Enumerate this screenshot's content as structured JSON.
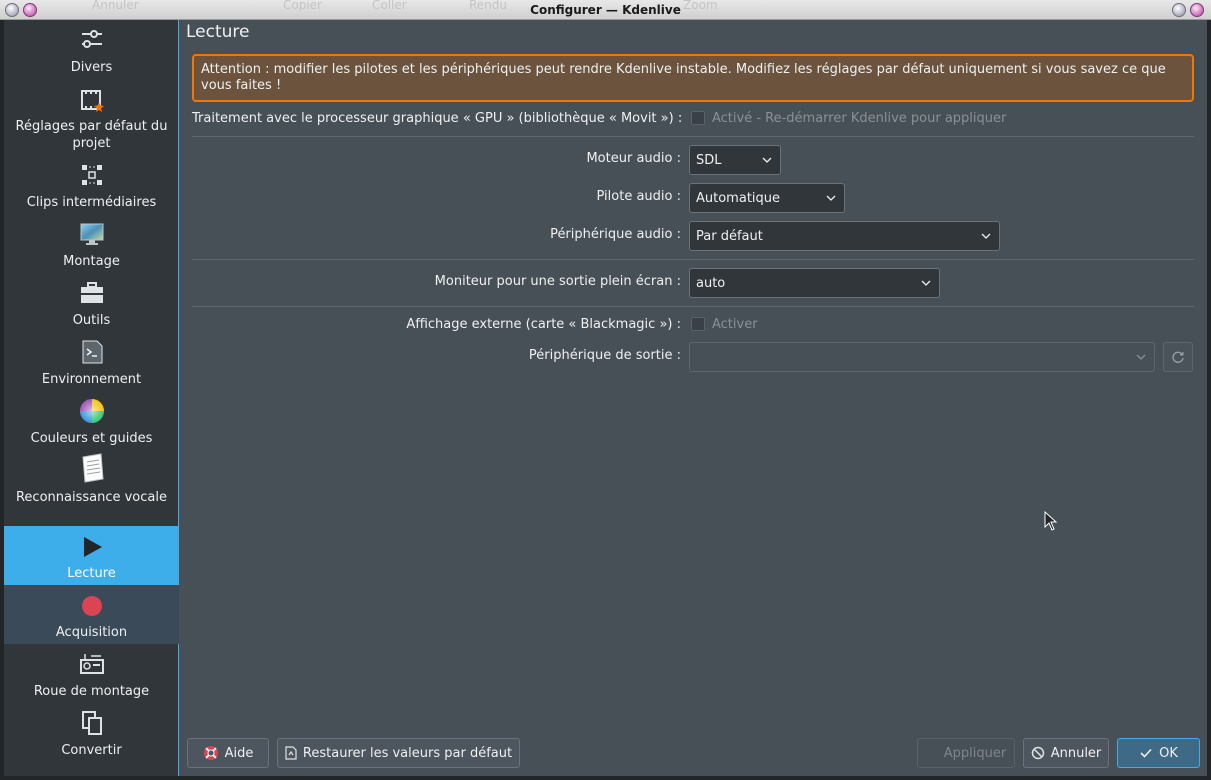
{
  "window": {
    "title": "Configurer — Kdenlive",
    "ghost_toolbar": [
      "Annuler",
      "Copier",
      "Coller",
      "Rendu",
      "Zoom"
    ]
  },
  "sidebar": {
    "items": [
      {
        "label": "Divers",
        "icon": "sliders-icon"
      },
      {
        "label": "Réglages par défaut du projet",
        "icon": "film-star-icon"
      },
      {
        "label": "Clips intermédiaires",
        "icon": "proxy-grid-icon"
      },
      {
        "label": "Montage",
        "icon": "monitor-icon"
      },
      {
        "label": "Outils",
        "icon": "toolbox-icon"
      },
      {
        "label": "Environnement",
        "icon": "terminal-icon"
      },
      {
        "label": "Couleurs et guides",
        "icon": "color-wheel-icon"
      },
      {
        "label": "Reconnaissance vocale",
        "icon": "notepad-icon"
      },
      {
        "label": "Lecture",
        "icon": "play-icon"
      },
      {
        "label": "Acquisition",
        "icon": "record-icon"
      },
      {
        "label": "Roue de montage",
        "icon": "jog-shuttle-icon"
      },
      {
        "label": "Convertir",
        "icon": "convert-icon"
      }
    ],
    "selected": "Lecture"
  },
  "page": {
    "title": "Lecture",
    "warning": "Attention : modifier les pilotes et les périphériques peut rendre Kdenlive instable. Modifiez les réglages par défaut uniquement si vous savez ce que vous faites !",
    "gpu": {
      "label": "Traitement avec le processeur graphique « GPU » (bibliothèque « Movit ») :",
      "checkbox_label": "Activé - Re-démarrer Kdenlive pour appliquer"
    },
    "audio_engine": {
      "label": "Moteur audio :",
      "value": "SDL"
    },
    "audio_driver": {
      "label": "Pilote audio :",
      "value": "Automatique"
    },
    "audio_device": {
      "label": "Périphérique audio :",
      "value": "Par défaut"
    },
    "fullscreen_monitor": {
      "label": "Moniteur pour une sortie plein écran :",
      "value": "auto"
    },
    "external_display": {
      "label": "Affichage externe (carte « Blackmagic ») :",
      "checkbox_label": "Activer"
    },
    "output_device": {
      "label": "Périphérique de sortie :",
      "value": ""
    }
  },
  "buttons": {
    "help": "Aide",
    "restore_defaults": "Restaurer les valeurs par défaut",
    "apply": "Appliquer",
    "cancel": "Annuler",
    "ok": "OK"
  },
  "colors": {
    "accent": "#3daee9",
    "warning_border": "#f67400",
    "record": "#da4453"
  }
}
